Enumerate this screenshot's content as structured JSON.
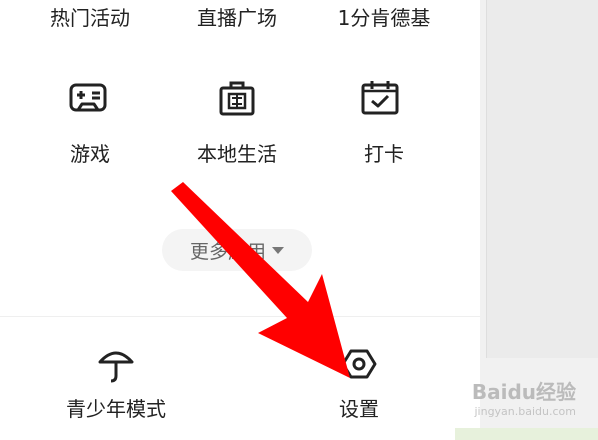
{
  "top_row": [
    {
      "label": "热门活动"
    },
    {
      "label": "直播广场"
    },
    {
      "label": "1分肯德基"
    }
  ],
  "apps": [
    {
      "label": "游戏",
      "icon": "gamepad-icon"
    },
    {
      "label": "本地生活",
      "icon": "shopping-bag-icon"
    },
    {
      "label": "打卡",
      "icon": "calendar-check-icon"
    }
  ],
  "more": {
    "label": "更多应用"
  },
  "bottom": [
    {
      "label": "青少年模式",
      "icon": "umbrella-icon"
    },
    {
      "label": "设置",
      "icon": "settings-hexagon-icon"
    }
  ],
  "watermark": {
    "brand": "Baidu经验",
    "sub": "jingyan.baidu.com"
  },
  "colors": {
    "arrow": "#ff0000",
    "text": "#222222"
  }
}
